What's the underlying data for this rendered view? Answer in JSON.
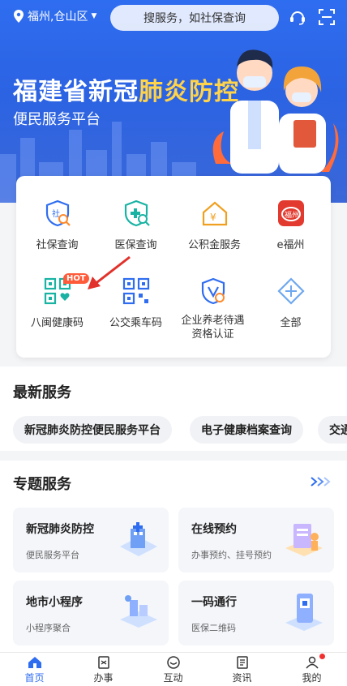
{
  "header": {
    "location": "福州,仓山区",
    "search_placeholder": "搜服务，如社保查询"
  },
  "banner": {
    "title_part1": "福建省",
    "title_part2": "新冠",
    "title_part3": "肺炎",
    "title_part4": "防控",
    "subtitle": "便民服务平台"
  },
  "grid": {
    "items": [
      {
        "label": "社保查询",
        "icon": "shield-search-icon"
      },
      {
        "label": "医保查询",
        "icon": "medical-shield-icon"
      },
      {
        "label": "公积金服务",
        "icon": "house-yuan-icon"
      },
      {
        "label": "e福州",
        "icon": "e-fuzhou-logo"
      },
      {
        "label": "八闽健康码",
        "icon": "health-qr-icon",
        "badge": "HOT"
      },
      {
        "label": "公交乘车码",
        "icon": "bus-qr-icon"
      },
      {
        "label": "企业养老待遇资格认证",
        "icon": "pension-shield-icon"
      },
      {
        "label": "全部",
        "icon": "all-diamond-icon"
      }
    ]
  },
  "latest": {
    "title": "最新服务",
    "chips": [
      "新冠肺炎防控便民服务平台",
      "电子健康档案查询",
      "交通"
    ]
  },
  "special": {
    "title": "专题服务",
    "cards": [
      {
        "title": "新冠肺炎防控",
        "subtitle": "便民服务平台"
      },
      {
        "title": "在线预约",
        "subtitle": "办事预约、挂号预约"
      },
      {
        "title": "地市小程序",
        "subtitle": "小程序聚合"
      },
      {
        "title": "一码通行",
        "subtitle": "医保二维码"
      }
    ]
  },
  "tabs": [
    {
      "label": "首页",
      "active": true
    },
    {
      "label": "办事",
      "active": false
    },
    {
      "label": "互动",
      "active": false
    },
    {
      "label": "资讯",
      "active": false
    },
    {
      "label": "我的",
      "active": false
    }
  ],
  "colors": {
    "primary": "#2f6df0",
    "highlight": "#ffd34a",
    "hot": "#ff5b3a"
  }
}
